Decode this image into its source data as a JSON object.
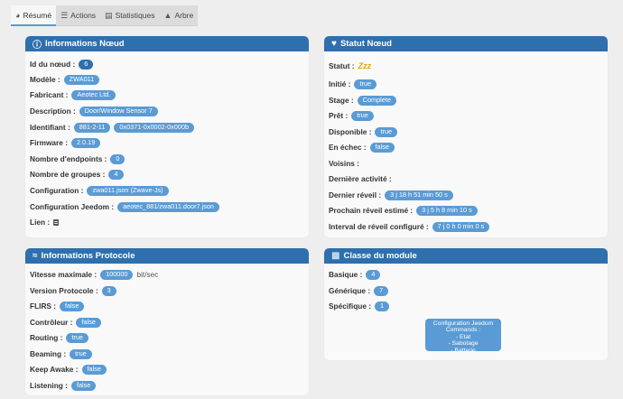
{
  "tabs": [
    {
      "label": "Résumé",
      "icon": "dashboard-icon"
    },
    {
      "label": "Actions",
      "icon": "list-icon"
    },
    {
      "label": "Statistiques",
      "icon": "bar-chart-icon"
    },
    {
      "label": "Arbre",
      "icon": "tree-icon"
    }
  ],
  "node_info": {
    "title": "Informations Nœud",
    "rows": [
      {
        "label": "Id du nœud :",
        "badges": [
          "6"
        ]
      },
      {
        "label": "Modèle :",
        "badges": [
          "ZWA011"
        ]
      },
      {
        "label": "Fabricant :",
        "badges": [
          "Aeotec Ltd."
        ]
      },
      {
        "label": "Description :",
        "badges": [
          "Door/Window Sensor 7"
        ]
      },
      {
        "label": "Identifiant :",
        "badges": [
          "881-2-11",
          "0x0371-0x0002-0x000b"
        ]
      },
      {
        "label": "Firmware :",
        "badges": [
          "2.0.19"
        ]
      },
      {
        "label": "Nombre d'endpoints :",
        "badges": [
          "0"
        ]
      },
      {
        "label": "Nombre de groupes :",
        "badges": [
          "4"
        ]
      },
      {
        "label": "Configuration :",
        "badges": [
          "zwa011.json (Zwave-Js)"
        ]
      },
      {
        "label": "Configuration Jeedom :",
        "badges": [
          "aeotec_881/zwa011.door7.json"
        ]
      },
      {
        "label": "Lien :",
        "badges": []
      }
    ]
  },
  "node_status": {
    "title": "Statut Nœud",
    "status_label": "Statut :",
    "status_symbol": "Zzz",
    "rows": [
      {
        "label": "Initié :",
        "badges": [
          "true"
        ]
      },
      {
        "label": "Stage :",
        "badges": [
          "Complete"
        ]
      },
      {
        "label": "Prêt :",
        "badges": [
          "true"
        ]
      },
      {
        "label": "Disponible :",
        "badges": [
          "true"
        ]
      },
      {
        "label": "En échec :",
        "badges": [
          "false"
        ]
      },
      {
        "label": "Voisins :",
        "badges": []
      },
      {
        "label": "Dernière activité :",
        "badges": []
      },
      {
        "label": "Dernier réveil :",
        "badges": [
          "3 j 18 h 51 min 50 s"
        ]
      },
      {
        "label": "Prochain réveil estimé :",
        "badges": [
          "3 j 5 h 8 min 10 s"
        ]
      },
      {
        "label": "Interval de réveil configuré :",
        "badges": [
          "7 j 0 h 0 min 0 s"
        ]
      }
    ]
  },
  "protocol_info": {
    "title": "Informations Protocole",
    "rows": [
      {
        "label": "Vitesse maximale :",
        "badges": [
          "100000"
        ],
        "unit": "bit/sec"
      },
      {
        "label": "Version Protocole :",
        "badges": [
          "3"
        ]
      },
      {
        "label": "FLIRS :",
        "badges": [
          "false"
        ]
      },
      {
        "label": "Contrôleur :",
        "badges": [
          "false"
        ]
      },
      {
        "label": "Routing :",
        "badges": [
          "true"
        ]
      },
      {
        "label": "Beaming :",
        "badges": [
          "true"
        ]
      },
      {
        "label": "Keep Awake :",
        "badges": [
          "false"
        ]
      },
      {
        "label": "Listening :",
        "badges": [
          "false"
        ]
      }
    ]
  },
  "module_class": {
    "title": "Classe du module",
    "rows": [
      {
        "label": "Basique :",
        "badges": [
          "4"
        ]
      },
      {
        "label": "Générique :",
        "badges": [
          "7"
        ]
      },
      {
        "label": "Spécifique :",
        "badges": [
          "1"
        ]
      }
    ],
    "box_lines": [
      "Configuration Jeedom",
      "Commands :",
      "- Etat",
      "- Sabotage",
      "- Batterie"
    ]
  },
  "colors": {
    "header": "#2e6fad",
    "badge": "#5a9bd5",
    "status_icon": "#e5a500"
  }
}
